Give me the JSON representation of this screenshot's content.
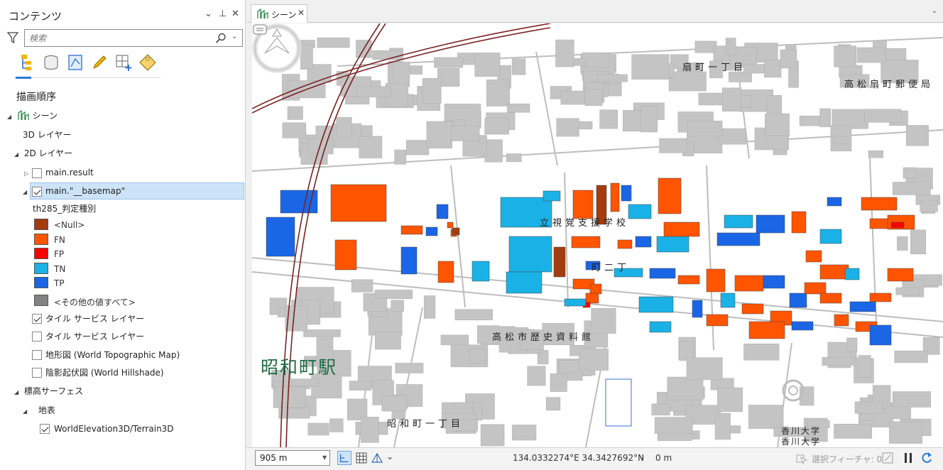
{
  "pane": {
    "title": "コンテンツ",
    "controls": {
      "dropdown": "⌄",
      "pin": "⊥",
      "close": "✕"
    },
    "search": {
      "placeholder": "検索"
    },
    "toolbar": [
      "list-by-drawing-order",
      "list-by-data-source",
      "list-by-selection",
      "list-by-editing",
      "list-by-snapping",
      "list-by-labeling"
    ],
    "section_title": "描画順序",
    "tree": {
      "scene": "シーン",
      "layers3d": "3D レイヤー",
      "layers2d": "2D レイヤー",
      "layer_result": "main.result",
      "layer_basemap": "main.\"__basemap\"",
      "legend_field": "th285_判定種別",
      "legend": [
        {
          "label": "<Null>",
          "color": "#a33c0f"
        },
        {
          "label": "FN",
          "color": "#ff5500"
        },
        {
          "label": "FP",
          "color": "#ff0000"
        },
        {
          "label": "TN",
          "color": "#1ab2e6"
        },
        {
          "label": "TP",
          "color": "#1a66e6"
        },
        {
          "label": "<その他の値すべて>",
          "color": "#828282"
        }
      ],
      "tile1": "タイル サービス レイヤー",
      "tile2": "タイル サービス レイヤー",
      "topo": "地形図 (World Topographic Map)",
      "hillshade": "陰影起伏図 (World Hillshade)",
      "elevation_surfaces": "標高サーフェス",
      "ground": "地表",
      "terrain": "WorldElevation3D/Terrain3D"
    }
  },
  "scene_tab": {
    "label": "シーン",
    "close": "✕"
  },
  "map": {
    "labels": {
      "ogimachi1": "扇町一丁目",
      "post_office": "高松扇町郵便局",
      "school": "立視覚支援学校",
      "chome2": "町二丁",
      "museum": "高松市歴史資料館",
      "station": "昭和町駅",
      "showa1": "昭和町一丁目",
      "univ1": "香川大学",
      "univ2": "香川大学"
    }
  },
  "status": {
    "scale": "905 m",
    "coords": "134.0332274°E 34.3427692°N",
    "elevation": "0 m",
    "selected": "選択フィーチャ: 0"
  }
}
